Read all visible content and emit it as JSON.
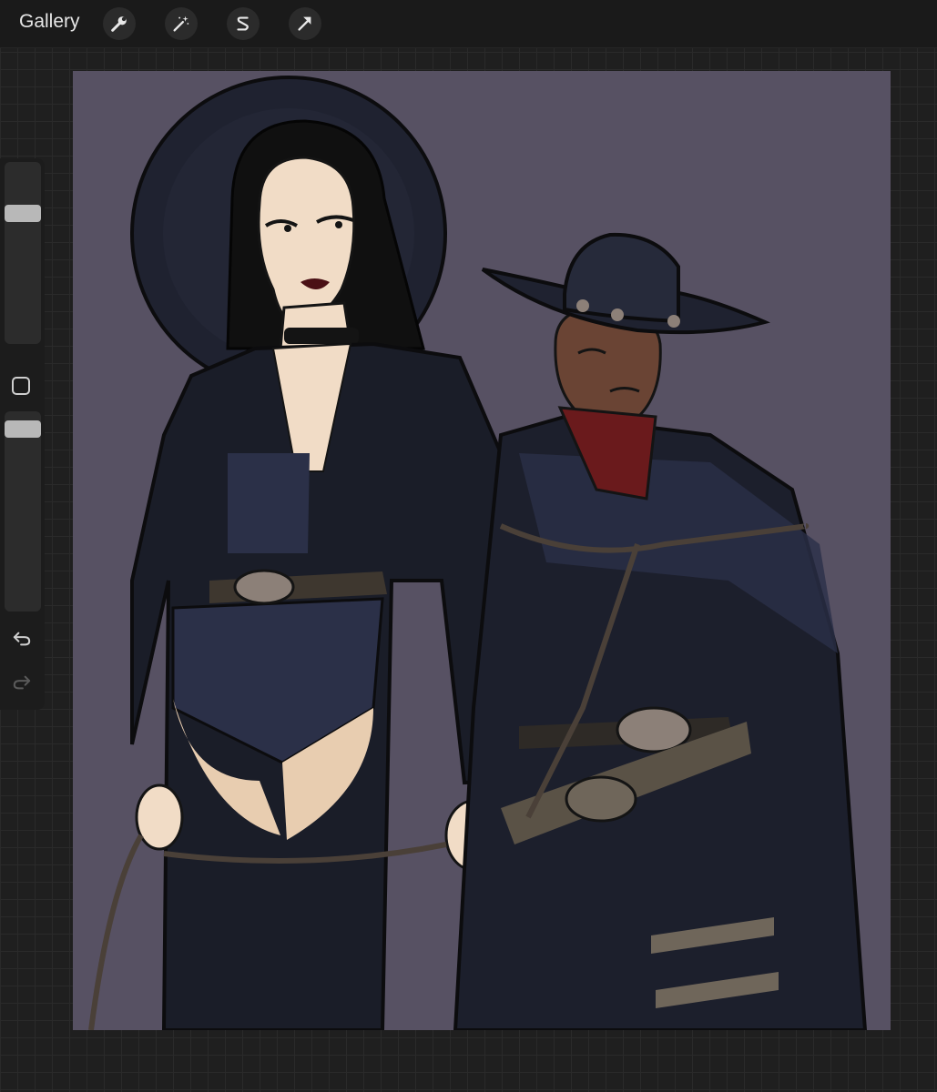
{
  "topbar": {
    "gallery_label": "Gallery",
    "tools": [
      {
        "icon": "wrench-icon"
      },
      {
        "icon": "magic-wand-icon"
      },
      {
        "icon": "selection-s-icon"
      },
      {
        "icon": "transform-arrow-icon"
      }
    ]
  },
  "sidebar": {
    "brush_size_level": 0.74,
    "opacity_level": 0.95,
    "undo_icon": "undo-icon",
    "redo_icon": "redo-icon"
  },
  "colors": {
    "background": "#575163",
    "toolbar": "#1a1a1a",
    "slider_thumb": "#b8b8b8"
  }
}
